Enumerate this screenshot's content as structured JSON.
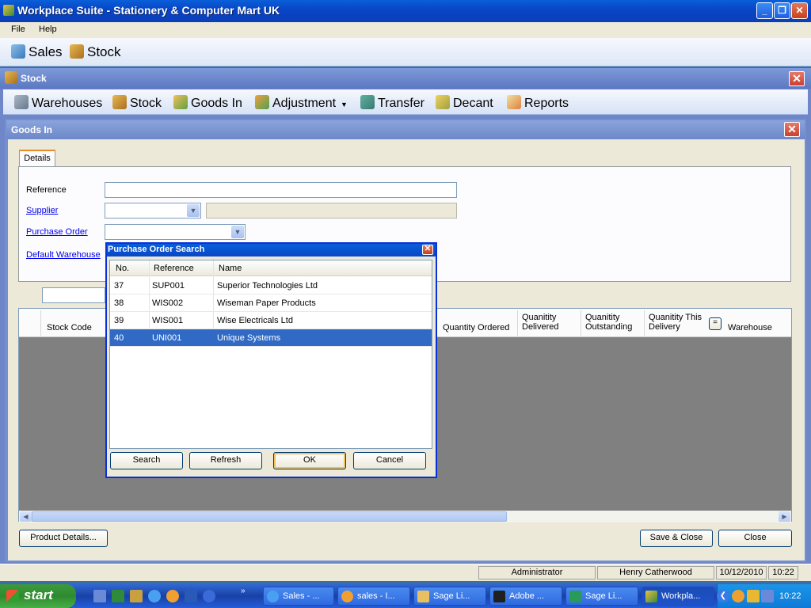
{
  "app": {
    "title": "Workplace Suite - Stationery & Computer Mart UK",
    "window_buttons": [
      "_",
      "❐",
      "✕"
    ]
  },
  "menu": {
    "file": "File",
    "help": "Help"
  },
  "main_toolbar": {
    "sales": "Sales",
    "stock": "Stock"
  },
  "stock_window": {
    "title": "Stock",
    "toolbar": {
      "warehouses": "Warehouses",
      "stock": "Stock",
      "goods_in": "Goods In",
      "adjustment": "Adjustment",
      "transfer": "Transfer",
      "decant": "Decant",
      "reports": "Reports"
    }
  },
  "goods_in": {
    "title": "Goods In",
    "tab": "Details",
    "fields": {
      "reference_label": "Reference",
      "supplier_label": "Supplier",
      "purchase_order_label": "Purchase Order",
      "default_warehouse_label": "Default Warehouse",
      "reference_value": "",
      "supplier_value": "",
      "purchase_order_value": ""
    },
    "grid_headers": {
      "stock_code": "Stock Code",
      "quantity_ordered": "Quantity Ordered",
      "quantity_delivered": "Quanitity Delivered",
      "quantity_outstanding": "Quanitity Outstanding",
      "quantity_this_delivery": "Quanitity This Delivery",
      "equals": "=",
      "warehouse": "Warehouse"
    },
    "buttons": {
      "product_details": "Product Details...",
      "save_close": "Save & Close",
      "close": "Close"
    }
  },
  "dialog": {
    "title": "Purchase Order Search",
    "columns": {
      "no": "No.",
      "reference": "Reference",
      "name": "Name"
    },
    "rows": [
      {
        "no": "37",
        "reference": "SUP001",
        "name": "Superior Technologies Ltd",
        "selected": false
      },
      {
        "no": "38",
        "reference": "WIS002",
        "name": "Wiseman Paper Products",
        "selected": false
      },
      {
        "no": "39",
        "reference": "WIS001",
        "name": "Wise Electricals Ltd",
        "selected": false
      },
      {
        "no": "40",
        "reference": "UNI001",
        "name": "Unique Systems",
        "selected": true
      }
    ],
    "buttons": {
      "search": "Search",
      "refresh": "Refresh",
      "ok": "OK",
      "cancel": "Cancel"
    }
  },
  "status_bar": {
    "user_role": "Administrator",
    "user_name": "Henry Catherwood",
    "date": "10/12/2010",
    "time": "10:22"
  },
  "taskbar": {
    "start": "start",
    "items": [
      {
        "label": "Sales - ...",
        "icon": "ie-icon"
      },
      {
        "label": "sales - I...",
        "icon": "clock-icon"
      },
      {
        "label": "Sage Li...",
        "icon": "folder-icon"
      },
      {
        "label": "Adobe ...",
        "icon": "adobe-icon"
      },
      {
        "label": "Sage Li...",
        "icon": "sage-icon"
      },
      {
        "label": "Workpla...",
        "icon": "workplace-icon"
      }
    ],
    "clock": "10:22",
    "colors": {
      "taskbar": "#245edb",
      "start": "#3c9a3c",
      "selection": "#316ac5"
    }
  }
}
